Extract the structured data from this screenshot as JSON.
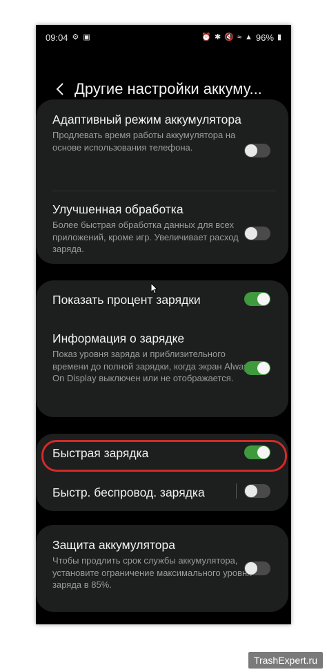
{
  "status_bar": {
    "time": "09:04",
    "battery": "96%"
  },
  "header": {
    "title": "Другие настройки аккуму..."
  },
  "cards": [
    {
      "rows": [
        {
          "title": "Адаптивный режим аккумулятора",
          "subtitle": "Продлевать время работы аккумулятора на основе использования телефона.",
          "toggle": false
        },
        {
          "title": "Улучшенная обработка",
          "subtitle": "Более быстрая обработка данных для всех приложений, кроме игр. Увеличивает расход заряда.",
          "toggle": false
        }
      ]
    },
    {
      "rows": [
        {
          "title": "Показать процент зарядки",
          "subtitle": "",
          "toggle": true
        },
        {
          "title": "Информация о зарядке",
          "subtitle": "Показ уровня заряда и приблизительного времени до полной зарядки, когда экран Always On Display выключен или не отображается.",
          "toggle": true
        }
      ]
    },
    {
      "rows": [
        {
          "title": "Быстрая зарядка",
          "subtitle": "",
          "toggle": true
        },
        {
          "title": "Быстр. беспровод. зарядка",
          "subtitle": "",
          "toggle": false
        }
      ]
    },
    {
      "rows": [
        {
          "title": "Защита аккумулятора",
          "subtitle": "Чтобы продлить срок службы аккумулятора, установите ограничение максимального уровня заряда в 85%.",
          "toggle": false
        }
      ]
    }
  ],
  "watermark": "TrashExpert.ru",
  "colors": {
    "toggle_on": "#3e9a3c",
    "toggle_off": "#4a4a4a",
    "card_bg": "#1d1f1e",
    "highlight": "#d32a2a"
  }
}
